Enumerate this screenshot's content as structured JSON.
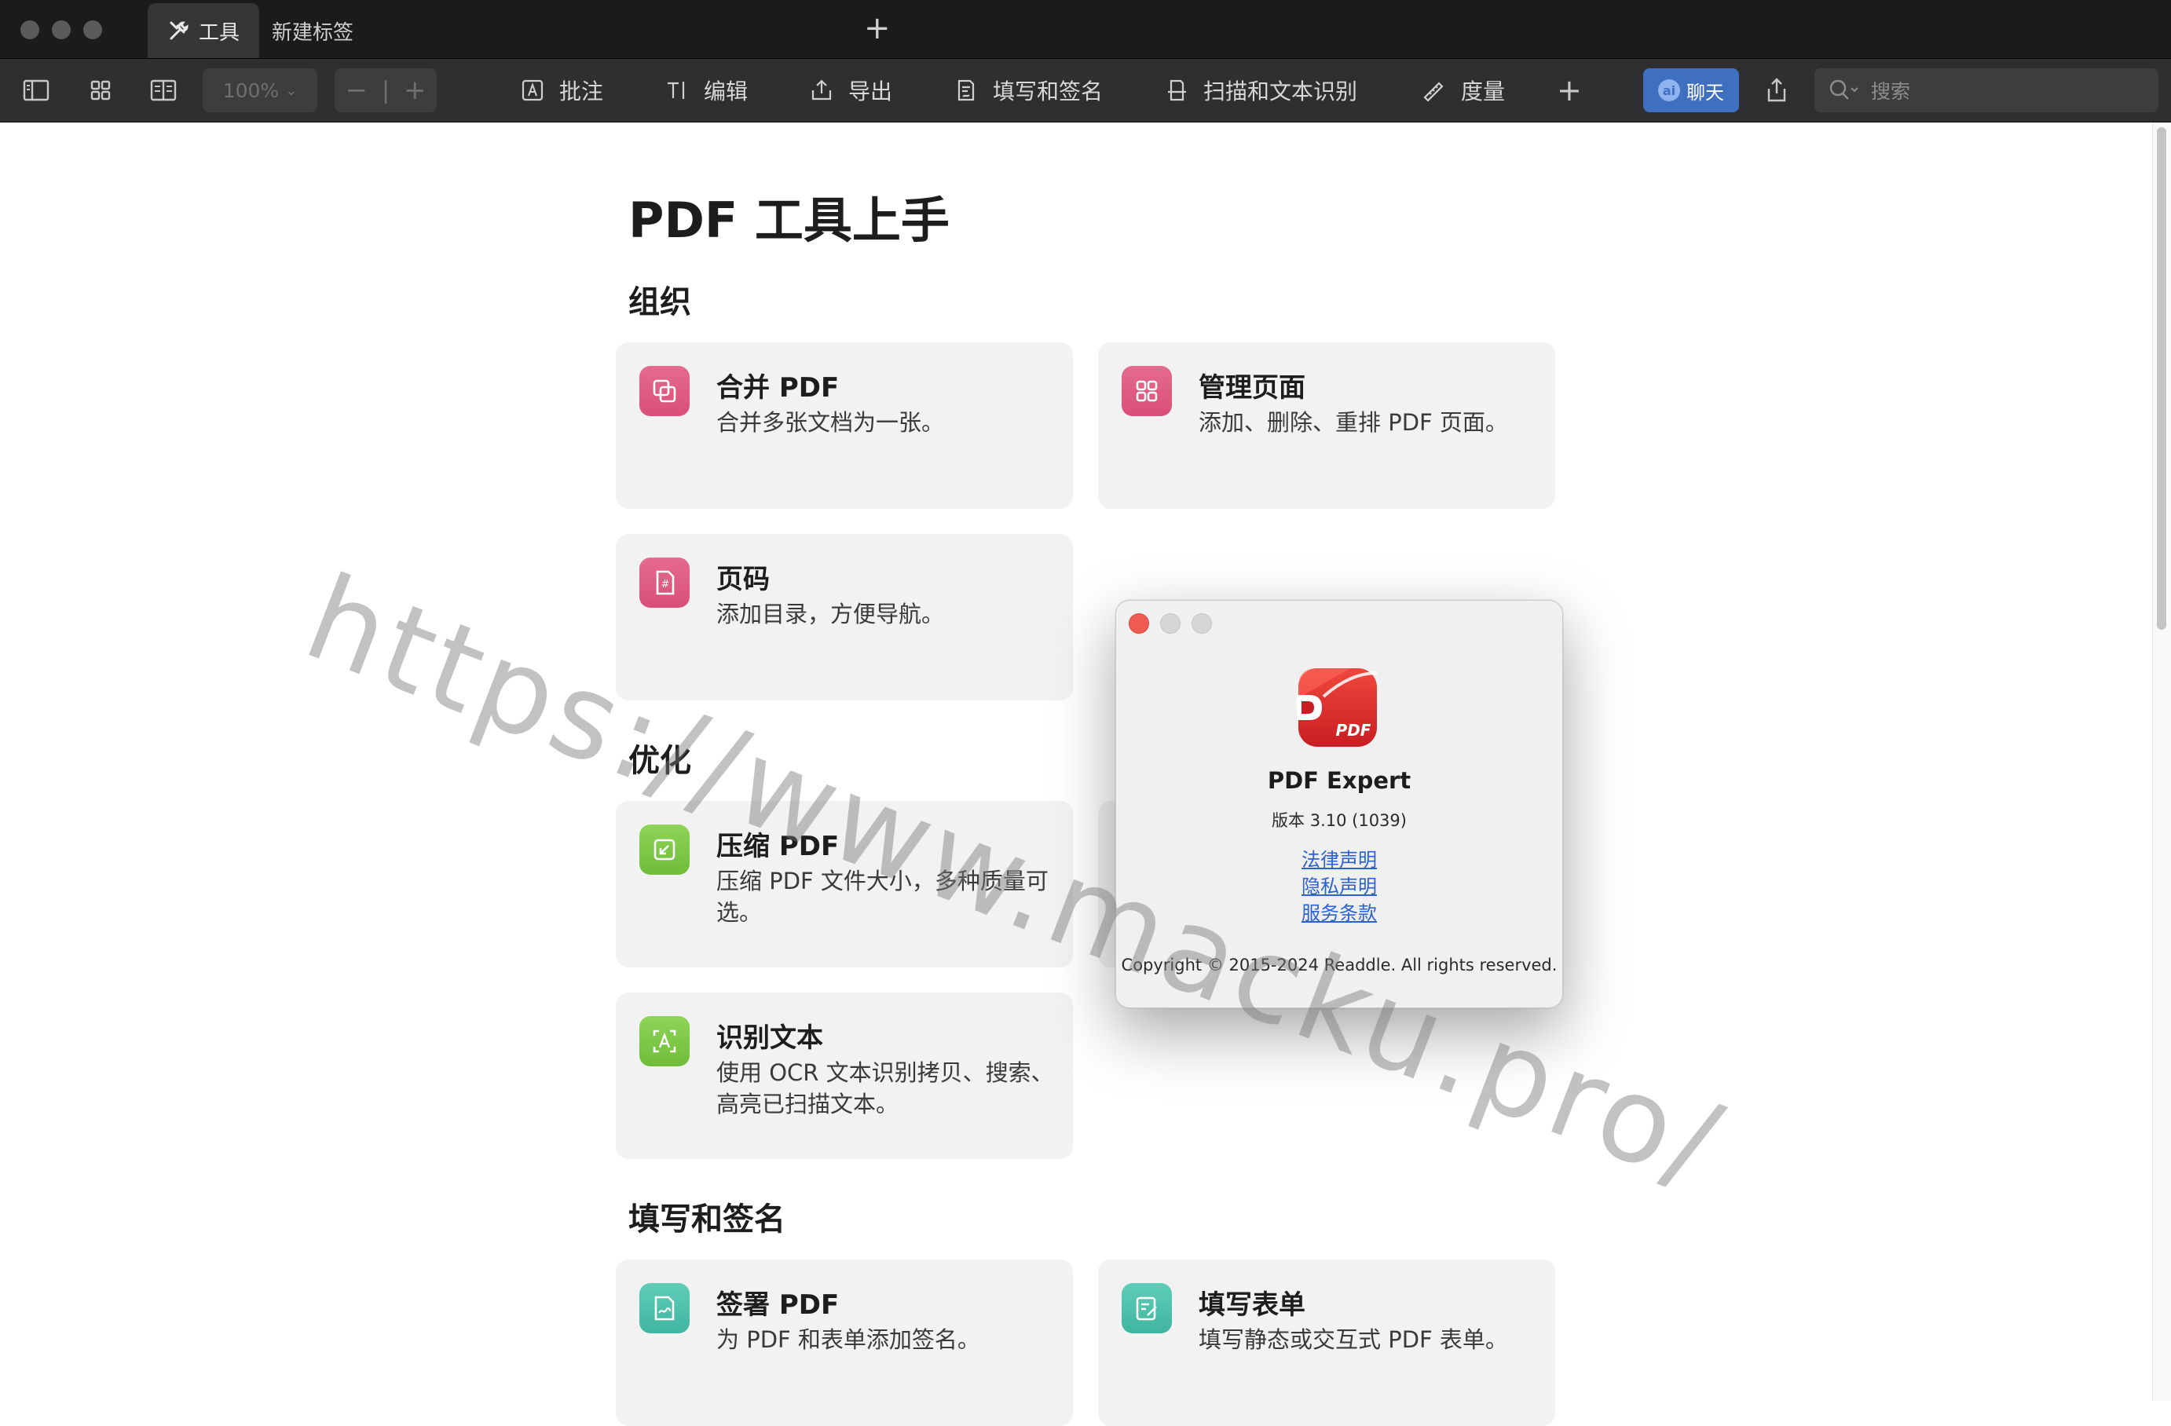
{
  "tabs": [
    {
      "label": "工具",
      "icon": "tools-icon",
      "active": true
    },
    {
      "label": "新建标签",
      "active": false
    }
  ],
  "toolbar": {
    "zoom": "100%",
    "items": [
      {
        "label": "批注",
        "icon": "annotate-icon"
      },
      {
        "label": "编辑",
        "icon": "edit-text-icon"
      },
      {
        "label": "导出",
        "icon": "export-icon"
      },
      {
        "label": "填写和签名",
        "icon": "fill-sign-icon"
      },
      {
        "label": "扫描和文本识别",
        "icon": "scan-ocr-icon"
      },
      {
        "label": "度量",
        "icon": "measure-icon"
      }
    ],
    "chat_label": "聊天",
    "chat_badge": "ai",
    "search_placeholder": "搜索"
  },
  "main": {
    "title": "PDF 工具上手",
    "sections": [
      {
        "title": "组织",
        "cards": [
          {
            "title": "合并 PDF",
            "desc": "合并多张文档为一张。",
            "icon": "merge-icon"
          },
          {
            "title": "管理页面",
            "desc": "添加、删除、重排 PDF 页面。",
            "icon": "pages-grid-icon"
          },
          {
            "title": "页码",
            "desc": "添加目录，方便导航。",
            "icon": "page-number-icon"
          }
        ]
      },
      {
        "title": "优化",
        "cards": [
          {
            "title": "压缩 PDF",
            "desc": "压缩 PDF 文件大小，多种质量可选。",
            "icon": "compress-icon"
          },
          {
            "title": "识别文本",
            "desc": "使用 OCR 文本识别拷贝、搜索、高亮已扫描文本。",
            "icon": "ocr-icon"
          }
        ]
      },
      {
        "title": "填写和签名",
        "cards": [
          {
            "title": "签署 PDF",
            "desc": "为 PDF 和表单添加签名。",
            "icon": "signature-icon"
          },
          {
            "title": "填写表单",
            "desc": "填写静态或交互式 PDF 表单。",
            "icon": "form-fill-icon"
          }
        ]
      }
    ]
  },
  "watermark": "https://www.macku.pro/",
  "about_dialog": {
    "app_name": "PDF Expert",
    "logo_text": "PDF",
    "version": "版本 3.10 (1039)",
    "links": [
      "法律声明",
      "隐私声明",
      "服务条款"
    ],
    "copyright": "Copyright © 2015-2024 Readdle. All rights reserved."
  },
  "colors": {
    "accent_pink": "#d84f78",
    "accent_green": "#6fbd3a",
    "accent_teal": "#3fb59f",
    "chat_button": "#3f6fbf",
    "link": "#2a62d4"
  }
}
